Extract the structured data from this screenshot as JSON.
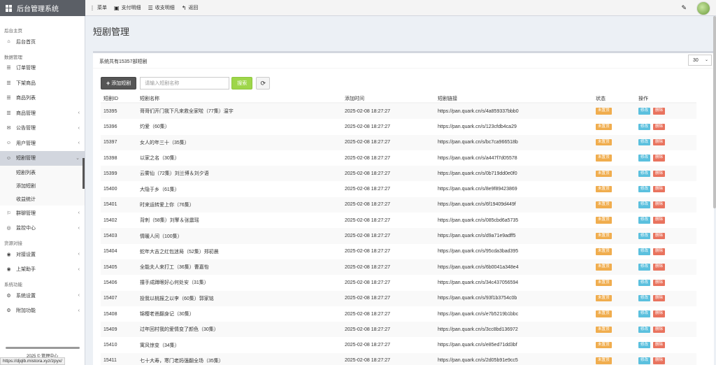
{
  "app": {
    "title": "后台管理系统"
  },
  "navbar": {
    "items": [
      {
        "icon": "⋮",
        "label": "菜单"
      },
      {
        "icon": "▣",
        "label": "支付明细"
      },
      {
        "icon": "☰",
        "label": "收支明细"
      },
      {
        "icon": "↰",
        "label": "返回"
      }
    ]
  },
  "sidebar": {
    "sections": [
      {
        "header": "后台主页",
        "items": [
          {
            "label": "后台首页",
            "icon": "⌂"
          }
        ]
      },
      {
        "header": "数据管理",
        "items": [
          {
            "label": "订单管理",
            "icon": "☰"
          },
          {
            "label": "下架商品",
            "icon": "☰"
          },
          {
            "label": "商品列表",
            "icon": "☰"
          },
          {
            "label": "商品管理",
            "icon": "☰"
          },
          {
            "label": "公告管理",
            "icon": "✉"
          },
          {
            "label": "用户管理",
            "icon": "☺"
          },
          {
            "label": "短剧管理",
            "icon": "☺"
          },
          {
            "label": "短剧列表"
          },
          {
            "label": "添加短剧"
          },
          {
            "label": "收益统计"
          },
          {
            "label": "群聊管理",
            "icon": "⚐"
          },
          {
            "label": "监控中心",
            "icon": "◎"
          }
        ]
      },
      {
        "header": "货源对接",
        "items": [
          {
            "label": "对接设置",
            "icon": "◉"
          },
          {
            "label": "上架助手",
            "icon": "◉"
          }
        ]
      },
      {
        "header": "系统功能",
        "items": [
          {
            "label": "系统设置",
            "icon": "⚙"
          },
          {
            "label": "附加功能",
            "icon": "⚙"
          }
        ]
      }
    ],
    "footer": "2025 © 管理中心"
  },
  "main": {
    "page_title": "短剧管理",
    "summary": "系统共有15357部短剧",
    "page_size": "30",
    "add_button": "添加短剧",
    "search_placeholder": "请输入短剧名称",
    "search_button": "搜索",
    "columns": [
      "短剧ID",
      "短剧名称",
      "添加时间",
      "短剧链接",
      "状态",
      "操作"
    ],
    "status_label": "未置顶",
    "edit_label": "修改",
    "delete_label": "删除",
    "rows": [
      {
        "id": "15395",
        "name": "哥哥们开门我下凡来救全家啦（77集）温宇",
        "time": "2025-02-08 18:27:27",
        "link": "https://pan.quark.cn/s/4a859337bbb0"
      },
      {
        "id": "15396",
        "name": "灼爱（60集）",
        "time": "2025-02-08 18:27:27",
        "link": "https://pan.quark.cn/s/123cfdb4ca29"
      },
      {
        "id": "15397",
        "name": "女人的年三十（35集）",
        "time": "2025-02-08 18:27:27",
        "link": "https://pan.quark.cn/s/bc7ca966518b"
      },
      {
        "id": "15398",
        "name": "以家之名（30集）",
        "time": "2025-02-08 18:27:27",
        "link": "https://pan.quark.cn/s/a447f7d05578"
      },
      {
        "id": "15399",
        "name": "云雾仙（72集）刘兰博＆刘夕语",
        "time": "2025-02-08 18:27:27",
        "link": "https://pan.quark.cn/s/0b719dd0e0f0"
      },
      {
        "id": "15400",
        "name": "大隐于乡（61集）",
        "time": "2025-02-08 18:27:27",
        "link": "https://pan.quark.cn/s/8e9f89423869"
      },
      {
        "id": "15401",
        "name": "时来运转爱上你（76集）",
        "time": "2025-02-08 18:27:27",
        "link": "https://pan.quark.cn/s/6f19409d449f"
      },
      {
        "id": "15402",
        "name": "背刺（58集）刘擎＆张震瑶",
        "time": "2025-02-08 18:27:27",
        "link": "https://pan.quark.cn/s/085cbd6a5735"
      },
      {
        "id": "15403",
        "name": "情暖人间（100集）",
        "time": "2025-02-08 18:27:27",
        "link": "https://pan.quark.cn/s/d9a71e9adff5"
      },
      {
        "id": "15404",
        "name": "蛇年大吉之红包迷局（52集）郑初晨",
        "time": "2025-02-08 18:27:27",
        "link": "https://pan.quark.cn/s/95cda3bad395"
      },
      {
        "id": "15405",
        "name": "全能夫人来打工（36集）曹嘉怡",
        "time": "2025-02-08 18:27:27",
        "link": "https://pan.quark.cn/s/6b0041a348e4"
      },
      {
        "id": "15406",
        "name": "撞手成蹲眼好心何处安（31集）",
        "time": "2025-02-08 18:27:27",
        "link": "https://pan.quark.cn/s/34c437056594"
      },
      {
        "id": "15407",
        "name": "投我以桃报之以李（60集）郭家铭",
        "time": "2025-02-08 18:27:27",
        "link": "https://pan.quark.cn/s/93f1b3754c0b"
      },
      {
        "id": "15408",
        "name": "锦樱老爸翻身记（30集）",
        "time": "2025-02-08 18:27:27",
        "link": "https://pan.quark.cn/s/e7b5219b1bbc"
      },
      {
        "id": "15409",
        "name": "过年回村我的爱情变了颜色（30集）",
        "time": "2025-02-08 18:27:27",
        "link": "https://pan.quark.cn/s/3cc8bd136972"
      },
      {
        "id": "15410",
        "name": "寓风惊变（34集）",
        "time": "2025-02-08 18:27:27",
        "link": "https://pan.quark.cn/s/e85ed71dd3bf"
      },
      {
        "id": "15411",
        "name": "七十大寿，寒门老妈强翻全场（35集）",
        "time": "2025-02-08 18:27:27",
        "link": "https://pan.quark.cn/s/2d05b91e9cc5"
      }
    ]
  },
  "statusbar": {
    "url": "https://djqlb.mistora.xyz/zpyx/"
  }
}
